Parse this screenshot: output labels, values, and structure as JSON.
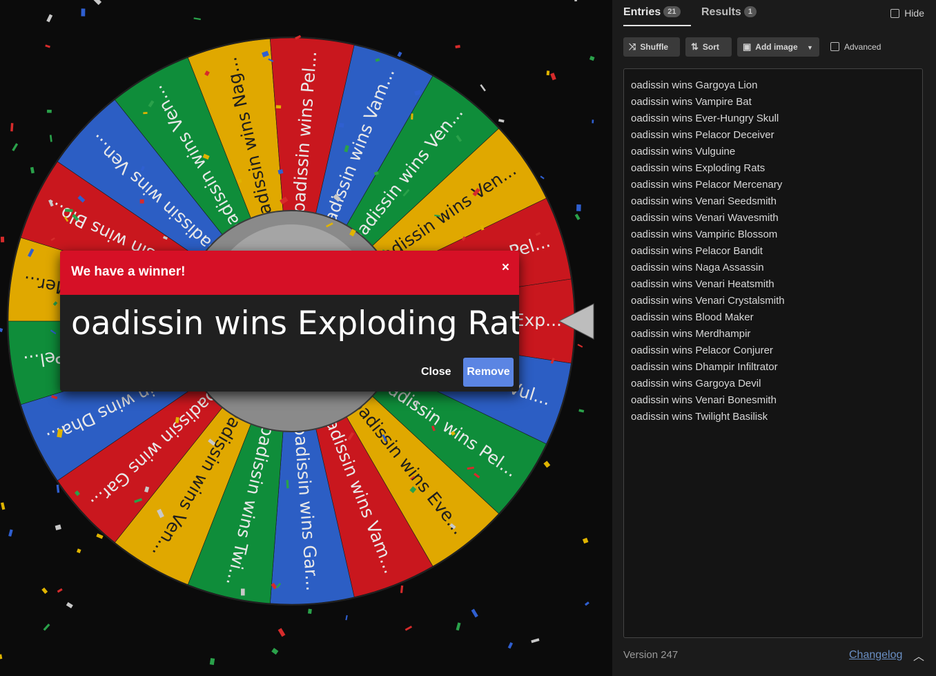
{
  "wheel": {
    "segment_labels": [
      "oadissin wins Exp...",
      "oadissin wins Vul...",
      "oadissin wins Pel...",
      "oadissin wins Eve...",
      "oadissin wins Vam...",
      "oadissin wins Gar...",
      "oadissin wins Twi...",
      "oadissin wins Ven...",
      "oadissin wins Gar...",
      "oadissin wins Dha...",
      "oadissin wins Pel...",
      "oadissin wins Mer...",
      "oadissin wins Blo...",
      "oadissin wins Ven...",
      "oadissin wins Ven...",
      "oadissin wins Nag...",
      "oadissin wins Pel...",
      "oadissin wins Vam...",
      "oadissin wins Ven...",
      "oadissin wins Ven...",
      "oadissin wins Pel..."
    ],
    "segment_colors": [
      "#c9171e",
      "#2c5ec4",
      "#0f8d3a",
      "#e0a800"
    ],
    "pointer_color": "#bdbdbd"
  },
  "dialog": {
    "title": "We have a winner!",
    "close_icon": "×",
    "winner": "oadissin wins Exploding Rats",
    "close_label": "Close",
    "remove_label": "Remove"
  },
  "panel": {
    "tabs": [
      {
        "label": "Entries",
        "count": "21"
      },
      {
        "label": "Results",
        "count": "1"
      }
    ],
    "hide_label": "Hide",
    "toolbar": {
      "shuffle": "Shuffle",
      "sort": "Sort",
      "add_image": "Add image",
      "advanced": "Advanced"
    },
    "entries": [
      "oadissin wins Gargoya Lion",
      "oadissin wins Vampire Bat",
      "oadissin wins Ever-Hungry Skull",
      "oadissin wins Pelacor Deceiver",
      "oadissin wins Vulguine",
      "oadissin wins Exploding Rats",
      "oadissin wins Pelacor Mercenary",
      "oadissin wins Venari Seedsmith",
      "oadissin wins Venari Wavesmith",
      "oadissin wins Vampiric Blossom",
      "oadissin wins Pelacor Bandit",
      "oadissin wins Naga Assassin",
      "oadissin wins Venari Heatsmith",
      "oadissin wins Venari Crystalsmith",
      "oadissin wins Blood Maker",
      "oadissin wins Merdhampir",
      "oadissin wins Pelacor Conjurer",
      "oadissin wins Dhampir Infiltrator",
      "oadissin wins Gargoya Devil",
      "oadissin wins Venari Bonesmith",
      "oadissin wins Twilight Basilisk"
    ],
    "version": "Version 247",
    "changelog": "Changelog",
    "chevron": "^"
  }
}
